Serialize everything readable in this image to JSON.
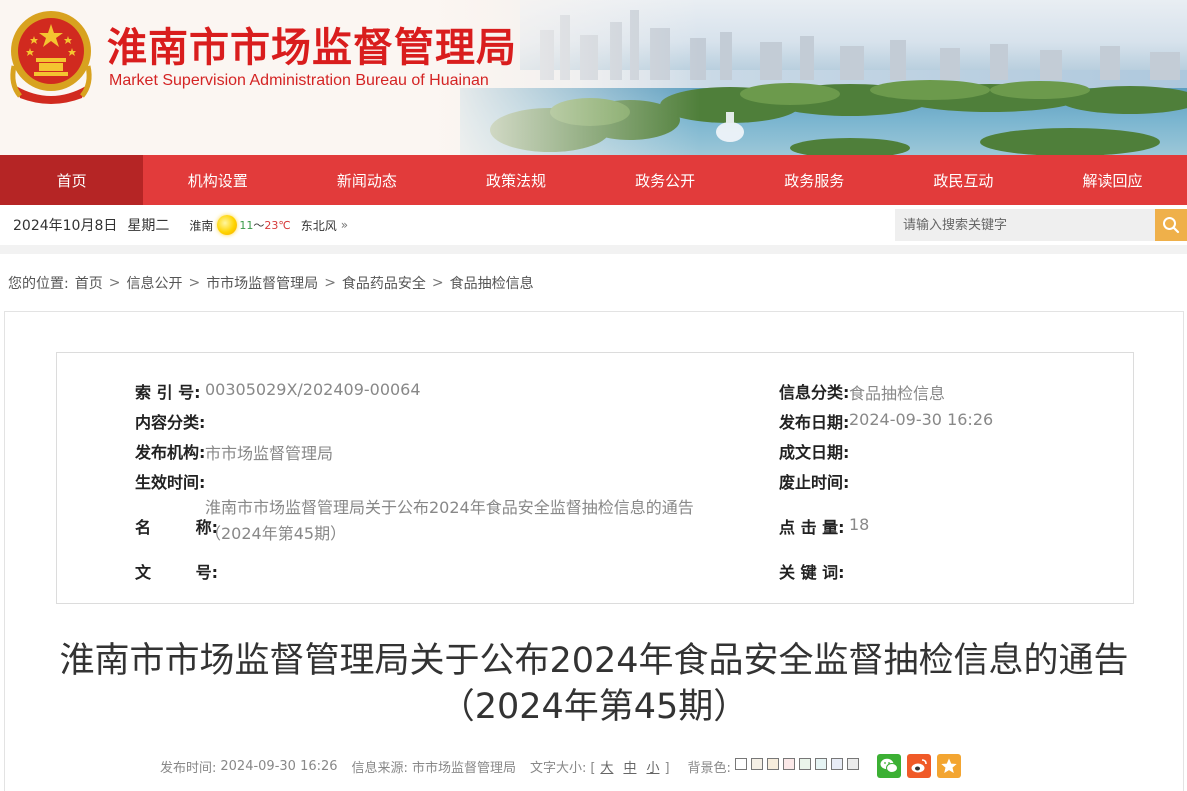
{
  "site": {
    "title": "淮南市市场监督管理局",
    "subtitle": "Market Supervision Administration Bureau of Huainan"
  },
  "nav": [
    {
      "label": "首页",
      "active": true
    },
    {
      "label": "机构设置"
    },
    {
      "label": "新闻动态"
    },
    {
      "label": "政策法规"
    },
    {
      "label": "政务公开"
    },
    {
      "label": "政务服务"
    },
    {
      "label": "政民互动"
    },
    {
      "label": "解读回应"
    }
  ],
  "infobar": {
    "date": "2024年10月8日",
    "weekday": "星期二",
    "city": "淮南",
    "temp_low": "11",
    "temp_sep": "～",
    "temp_high": "23℃",
    "wind": "东北风",
    "more": "»"
  },
  "search": {
    "placeholder": "请输入搜索关键字"
  },
  "breadcrumb": {
    "prefix": "您的位置:",
    "items": [
      "首页",
      "信息公开",
      "市市场监督管理局",
      "食品药品安全",
      "食品抽检信息"
    ],
    "separator": ">"
  },
  "meta": {
    "index_label": "索  引  号:",
    "index_value": "00305029X/202409-00064",
    "category_label": "信息分类:",
    "category_value": "食品抽检信息",
    "content_type_label": "内容分类:",
    "content_type_value": "",
    "publish_date_label": "发布日期:",
    "publish_date_value": "2024-09-30 16:26",
    "publisher_label": "发布机构:",
    "publisher_value": "市市场监督管理局",
    "written_date_label": "成文日期:",
    "written_date_value": "",
    "effective_label": "生效时间:",
    "effective_value": "",
    "expire_label": "废止时间:",
    "expire_value": "",
    "name_label": "名        称:",
    "name_value": "淮南市市场监督管理局关于公布2024年食品安全监督抽检信息的通告（2024年第45期）",
    "clicks_label": "点  击  量:",
    "clicks_value": "18",
    "doc_no_label": "文        号:",
    "doc_no_value": "",
    "keywords_label": "关  键  词:",
    "keywords_value": ""
  },
  "article": {
    "title": "淮南市市场监督管理局关于公布2024年食品安全监督抽检信息的通告（2024年第45期）",
    "publish_time_label": "发布时间:",
    "publish_time": "2024-09-30 16:26",
    "source_label": "信息来源:",
    "source": "市市场监督管理局",
    "font_size_label": "文字大小:",
    "font_open": "[",
    "font_large": "大",
    "font_medium": "中",
    "font_small": "小",
    "font_close": "]",
    "bg_label": "背景色:",
    "bg_colors": [
      "#ffffff",
      "#f5f0e6",
      "#f7eddc",
      "#fbe8e8",
      "#eaf5ea",
      "#e6f4f4",
      "#e8ecf6",
      "#ececec"
    ]
  },
  "colors": {
    "brand_red": "#e23b3b",
    "nav_active": "#b52525",
    "search_btn": "#efb04a",
    "wechat": "#3cb034",
    "weibo": "#f05a28",
    "favorite": "#f3a531"
  },
  "icons": [
    "national-emblem-icon",
    "sun-icon",
    "search-icon",
    "wechat-icon",
    "weibo-icon",
    "favorite-star-icon"
  ]
}
